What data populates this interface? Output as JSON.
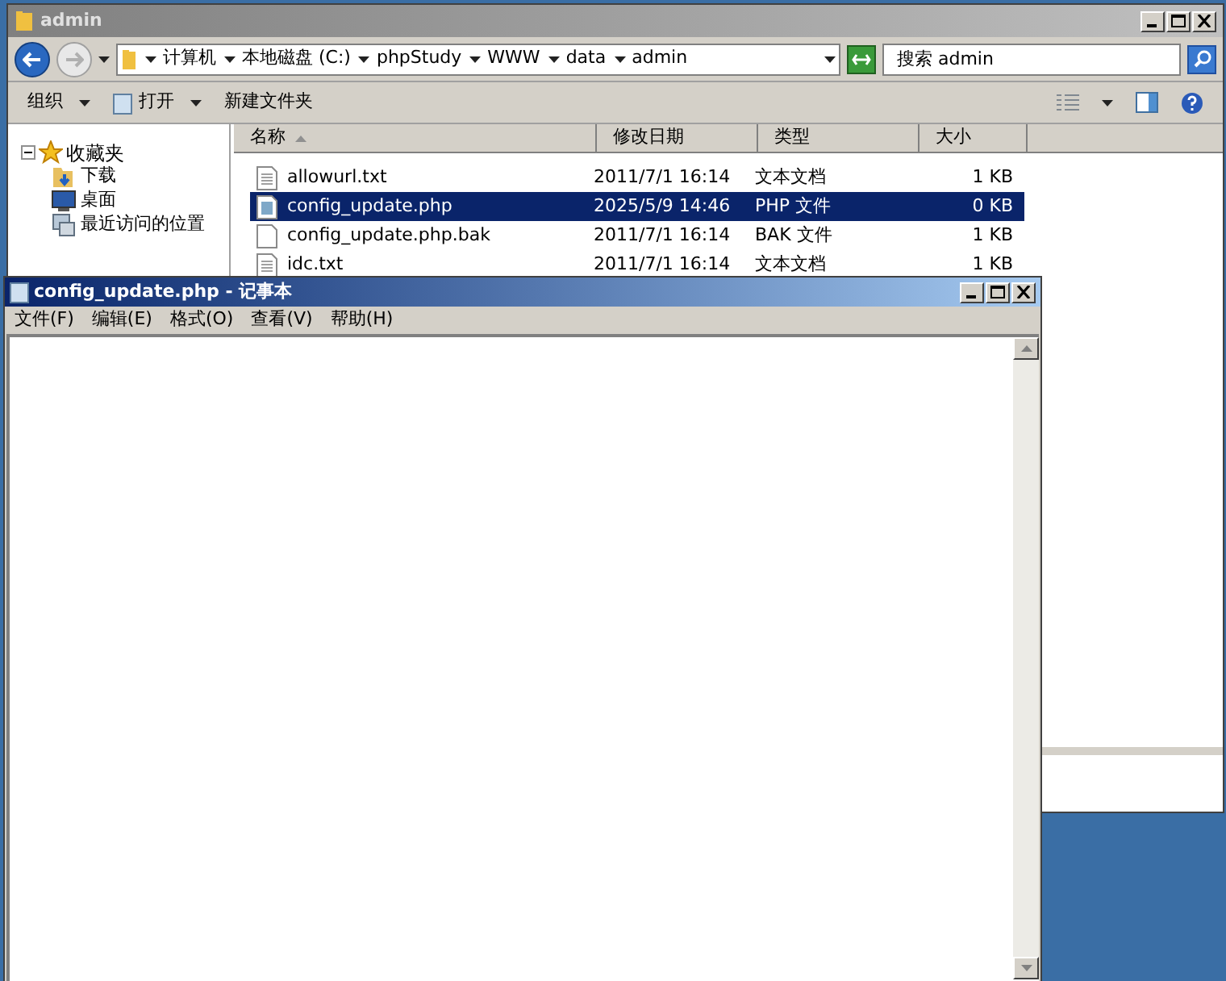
{
  "explorer": {
    "title": "admin",
    "breadcrumb": [
      "计算机",
      "本地磁盘 (C:)",
      "phpStudy",
      "WWW",
      "data",
      "admin"
    ],
    "search": {
      "placeholder": "搜索 admin"
    },
    "toolbar": [
      {
        "label": "组织",
        "menu": true,
        "kind": "plain"
      },
      {
        "label": "打开",
        "menu": true,
        "kind": "open"
      },
      {
        "label": "新建文件夹",
        "menu": false,
        "kind": "plain"
      }
    ],
    "nav": [
      {
        "label": "收藏夹",
        "expanded": true,
        "kind": "star",
        "children": [
          {
            "label": "下载",
            "kind": "download"
          },
          {
            "label": "桌面",
            "kind": "desktop"
          },
          {
            "label": "最近访问的位置",
            "kind": "recent"
          }
        ]
      }
    ],
    "columns": [
      "名称",
      "修改日期",
      "类型",
      "大小"
    ],
    "files": [
      {
        "name": "allowurl.txt",
        "date": "2011/7/1 16:14",
        "type": "文本文档",
        "size": "1 KB",
        "selected": false,
        "kind": "text"
      },
      {
        "name": "config_update.php",
        "date": "2025/5/9 14:46",
        "type": "PHP 文件",
        "size": "0 KB",
        "selected": true,
        "kind": "php"
      },
      {
        "name": "config_update.php.bak",
        "date": "2011/7/1 16:14",
        "type": "BAK 文件",
        "size": "1 KB",
        "selected": false,
        "kind": "blank"
      },
      {
        "name": "idc.txt",
        "date": "2011/7/1 16:14",
        "type": "文本文档",
        "size": "1 KB",
        "selected": false,
        "kind": "text"
      }
    ]
  },
  "notepad": {
    "title": "config_update.php - 记事本",
    "menu": [
      "文件(F)",
      "编辑(E)",
      "格式(O)",
      "查看(V)",
      "帮助(H)"
    ]
  }
}
